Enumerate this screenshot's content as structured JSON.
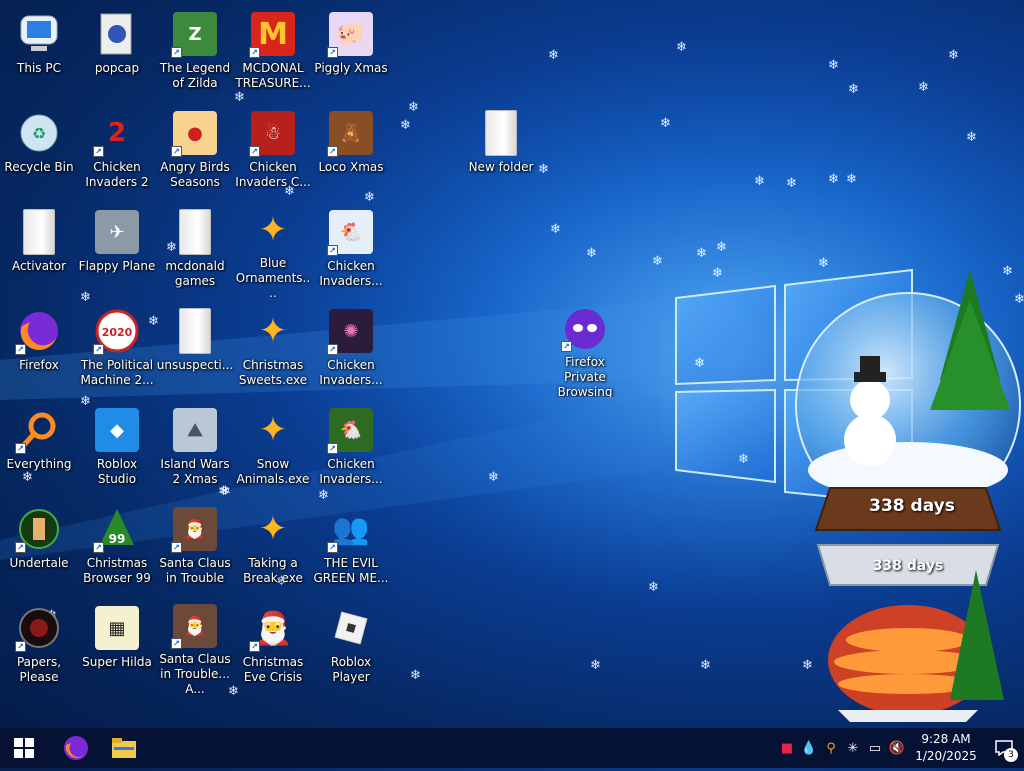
{
  "desktop": {
    "icons": [
      {
        "id": "this-pc",
        "label": "This PC",
        "kind": "computer",
        "shortcut": false
      },
      {
        "id": "popcap",
        "label": "popcap",
        "kind": "folder-blue",
        "shortcut": false
      },
      {
        "id": "legend-of-zilda",
        "label": "The Legend of Zilda",
        "kind": "game-green",
        "shortcut": true
      },
      {
        "id": "mcdonald-treasure",
        "label": "MCDONAL TREASURE...",
        "kind": "mcdonalds",
        "shortcut": true
      },
      {
        "id": "piggly-xmas",
        "label": "Piggly Xmas",
        "kind": "pig",
        "shortcut": true
      },
      {
        "id": "recycle-bin",
        "label": "Recycle Bin",
        "kind": "recycle",
        "shortcut": false
      },
      {
        "id": "chicken-invaders-2",
        "label": "Chicken Invaders 2",
        "kind": "chicken2",
        "shortcut": true
      },
      {
        "id": "angry-birds-seasons",
        "label": "Angry Birds Seasons",
        "kind": "angry",
        "shortcut": true
      },
      {
        "id": "chicken-invaders-c",
        "label": "Chicken Invaders C...",
        "kind": "snowman-red",
        "shortcut": true
      },
      {
        "id": "loco-xmas",
        "label": "Loco Xmas",
        "kind": "bear",
        "shortcut": true
      },
      {
        "id": "new-folder",
        "label": "New folder",
        "kind": "folder",
        "shortcut": false
      },
      {
        "id": "activator",
        "label": "Activator",
        "kind": "folder",
        "shortcut": false
      },
      {
        "id": "flappy-plane",
        "label": "Flappy Plane",
        "kind": "photo",
        "shortcut": false
      },
      {
        "id": "mcdonald-games",
        "label": "mcdonald games",
        "kind": "folder",
        "shortcut": false
      },
      {
        "id": "blue-ornaments",
        "label": "Blue Ornaments....",
        "kind": "puzzle",
        "shortcut": false
      },
      {
        "id": "chicken-invaders-a",
        "label": "Chicken Invaders...",
        "kind": "chicken-santa",
        "shortcut": true
      },
      {
        "id": "firefox",
        "label": "Firefox",
        "kind": "firefox",
        "shortcut": true
      },
      {
        "id": "political-machine",
        "label": "The Political Machine 2...",
        "kind": "political",
        "shortcut": true
      },
      {
        "id": "unsuspecti",
        "label": "unsuspecti...",
        "kind": "folder",
        "shortcut": false
      },
      {
        "id": "christmas-sweets",
        "label": "Christmas Sweets.exe",
        "kind": "puzzle",
        "shortcut": false
      },
      {
        "id": "chicken-invaders-b",
        "label": "Chicken Invaders...",
        "kind": "chicken-space",
        "shortcut": true
      },
      {
        "id": "firefox-private",
        "label": "Firefox Private Browsing",
        "kind": "private",
        "shortcut": true
      },
      {
        "id": "everything",
        "label": "Everything",
        "kind": "everything",
        "shortcut": true
      },
      {
        "id": "roblox-studio",
        "label": "Roblox Studio",
        "kind": "roblox-studio",
        "shortcut": false
      },
      {
        "id": "island-wars",
        "label": "Island Wars 2 Xmas",
        "kind": "island",
        "shortcut": false
      },
      {
        "id": "snow-animals",
        "label": "Snow Animals.exe",
        "kind": "puzzle",
        "shortcut": false
      },
      {
        "id": "chicken-invaders-d",
        "label": "Chicken Invaders...",
        "kind": "chicken-green",
        "shortcut": true
      },
      {
        "id": "undertale",
        "label": "Undertale",
        "kind": "undertale",
        "shortcut": true
      },
      {
        "id": "christmas-browser",
        "label": "Christmas Browser 99",
        "kind": "xmas-tree",
        "shortcut": true
      },
      {
        "id": "santa-claus-trouble",
        "label": "Santa Claus in Trouble",
        "kind": "santa",
        "shortcut": true
      },
      {
        "id": "taking-a-break",
        "label": "Taking a Break.exe",
        "kind": "puzzle",
        "shortcut": false
      },
      {
        "id": "evil-green-me",
        "label": "THE EVIL GREEN ME...",
        "kind": "messenger",
        "shortcut": true
      },
      {
        "id": "papers-please",
        "label": "Papers, Please",
        "kind": "papers",
        "shortcut": true
      },
      {
        "id": "super-hilda",
        "label": "Super Hilda",
        "kind": "pixel",
        "shortcut": false
      },
      {
        "id": "santa-claus-trouble-a",
        "label": "Santa Claus in Trouble... A...",
        "kind": "santa",
        "shortcut": true
      },
      {
        "id": "christmas-eve-crisis",
        "label": "Christmas Eve Crisis",
        "kind": "santa-face",
        "shortcut": true
      },
      {
        "id": "roblox-player",
        "label": "Roblox Player",
        "kind": "roblox",
        "shortcut": false
      }
    ]
  },
  "gadget": {
    "days_top": "338 days",
    "days_bottom": "338 days"
  },
  "taskbar": {
    "start_icon": "windows-logo-icon",
    "pinned": [
      {
        "id": "firefox",
        "icon": "firefox-icon"
      },
      {
        "id": "file-explorer",
        "icon": "folder-icon"
      }
    ],
    "tray": [
      {
        "id": "app-tray",
        "icon": "app-icon"
      },
      {
        "id": "drop-tray",
        "icon": "drop-icon"
      },
      {
        "id": "search-tray",
        "icon": "search-icon"
      },
      {
        "id": "snow-tray",
        "icon": "snowflake-icon"
      },
      {
        "id": "network",
        "icon": "network-icon"
      },
      {
        "id": "volume",
        "icon": "volume-muted-icon"
      }
    ],
    "time": "9:28 AM",
    "date": "1/20/2025",
    "notification_count": "3"
  },
  "colors": {
    "taskbar": "#061234",
    "accent": "#2f8de8"
  }
}
